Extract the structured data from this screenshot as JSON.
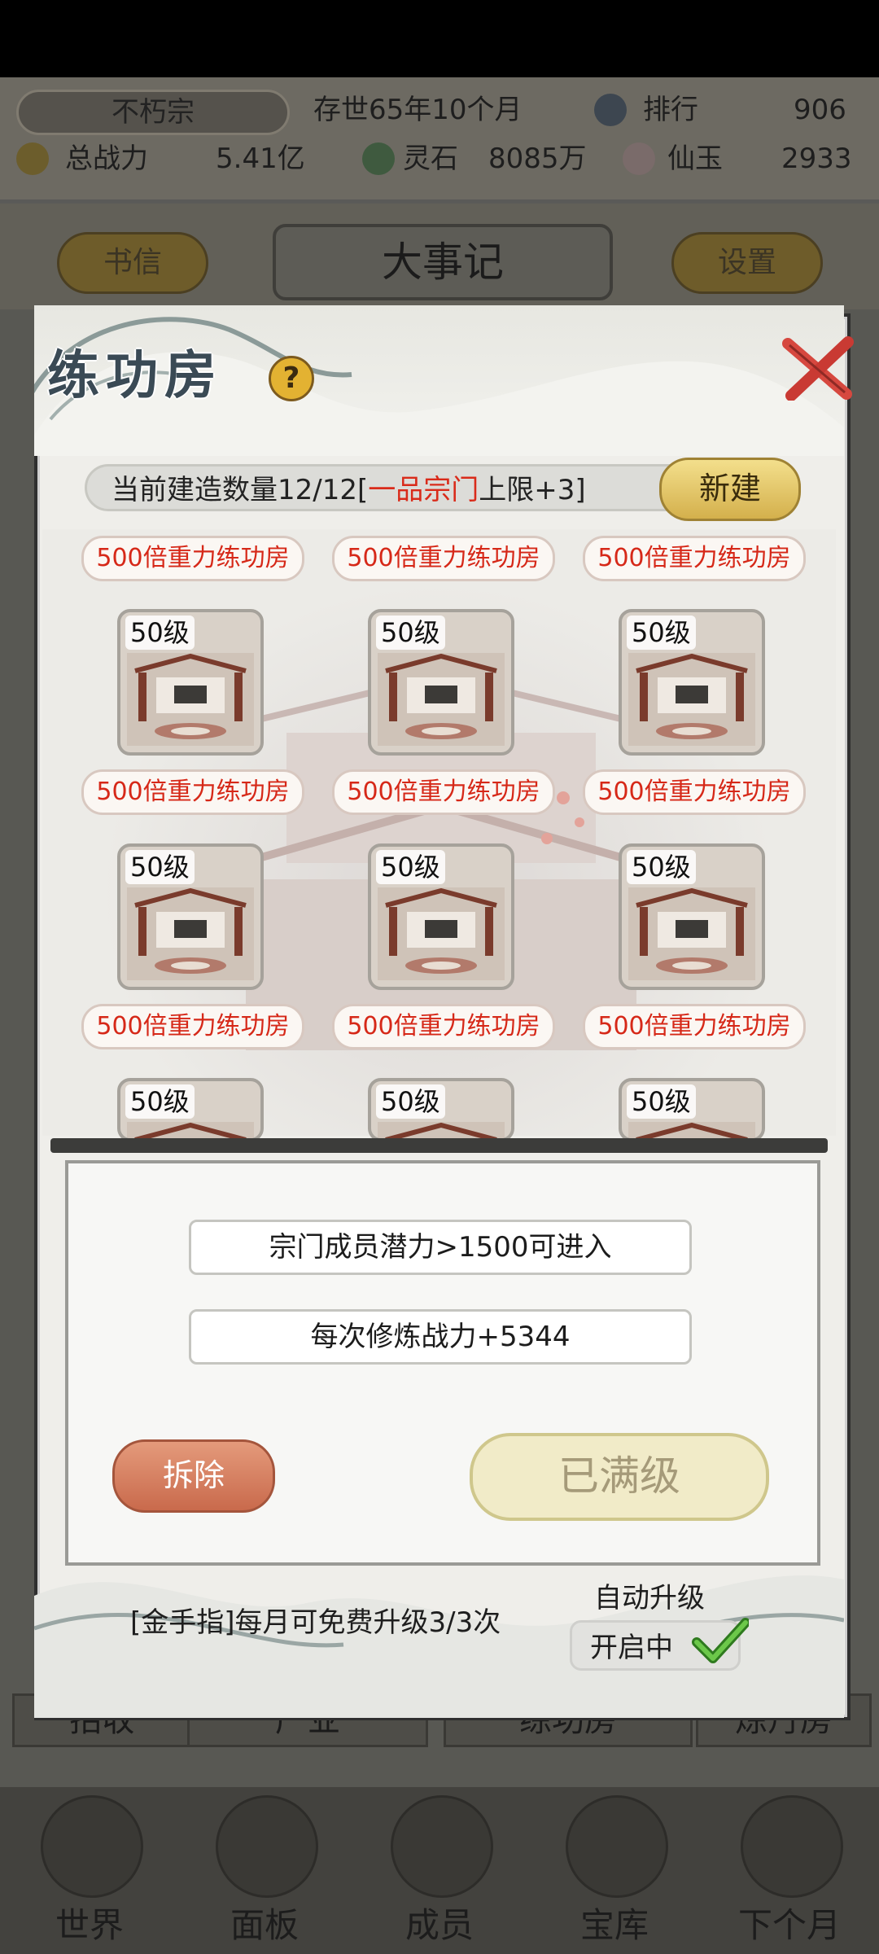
{
  "header": {
    "sect_name": "不朽宗",
    "era": "存世65年10个月",
    "rank_label": "排行",
    "rank_value": "906",
    "power_label": "总战力",
    "power_value": "5.41亿",
    "spirit_stone_label": "灵石",
    "spirit_stone_value": "8085万",
    "jade_label": "仙玉",
    "jade_value": "2933"
  },
  "nav": {
    "letters_label": "书信",
    "title": "大事记",
    "settings_label": "设置"
  },
  "background_tabs": [
    "招收",
    "产业",
    "练功房",
    "炼丹房"
  ],
  "bottom_nav": [
    "世界",
    "面板",
    "成员",
    "宝库",
    "下个月"
  ],
  "dialog": {
    "title": "练功房",
    "help_glyph": "?",
    "count_prefix": "当前建造数量12/12[",
    "count_highlight": "一品宗门",
    "count_suffix": "上限+3]",
    "new_label": "新建",
    "rooms": [
      {
        "name": "500倍重力练功房",
        "level": "50级"
      },
      {
        "name": "500倍重力练功房",
        "level": "50级"
      },
      {
        "name": "500倍重力练功房",
        "level": "50级"
      },
      {
        "name": "500倍重力练功房",
        "level": "50级"
      },
      {
        "name": "500倍重力练功房",
        "level": "50级"
      },
      {
        "name": "500倍重力练功房",
        "level": "50级"
      },
      {
        "name": "500倍重力练功房",
        "level": "50级"
      },
      {
        "name": "500倍重力练功房",
        "level": "50级"
      },
      {
        "name": "500倍重力练功房",
        "level": "50级"
      }
    ],
    "requirement": "宗门成员潜力>1500可进入",
    "bonus": "每次修炼战力+5344",
    "demolish_label": "拆除",
    "maxed_label": "已满级",
    "gold_finger": "[金手指]每月可免费升级3/3次",
    "auto_upgrade_label": "自动升级",
    "auto_upgrade_state": "开启中"
  },
  "colors": {
    "highlight_red": "#d92b1a",
    "title_slate": "#3a4a55",
    "gold": "#d4b04c"
  }
}
